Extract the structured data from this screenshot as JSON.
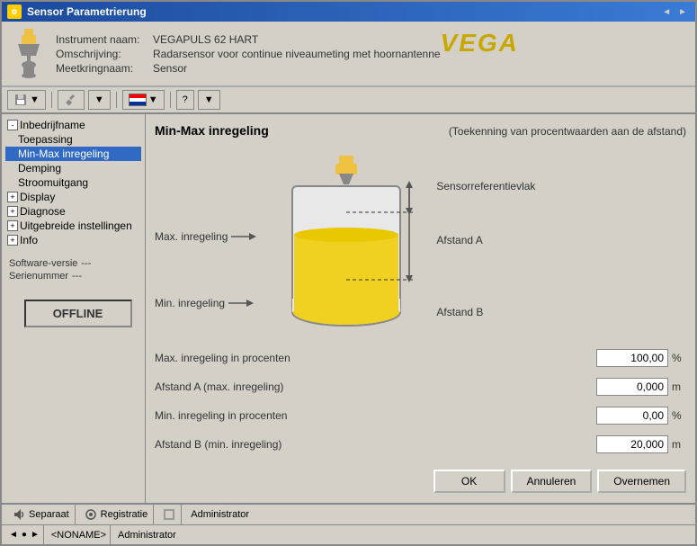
{
  "window": {
    "title": "Sensor Parametrierung",
    "nav_prev": "◄",
    "nav_next": "►"
  },
  "header": {
    "instrument_label": "Instrument naam:",
    "instrument_value": "VEGAPULS 62 HART",
    "description_label": "Omschrijving:",
    "description_value": "Radarsensor voor continue niveaumeting met hoornantenne",
    "circuit_label": "Meetkringnaam:",
    "circuit_value": "Sensor",
    "logo": "VEGA"
  },
  "toolbar": {
    "btn1": "▼",
    "btn2": "🔧",
    "btn3": "▼",
    "btn4": "?",
    "btn5": "▼"
  },
  "sidebar": {
    "items": [
      {
        "label": "Inbedrijfname",
        "level": 0,
        "expanded": true,
        "selected": false
      },
      {
        "label": "Toepassing",
        "level": 1,
        "expanded": false,
        "selected": false
      },
      {
        "label": "Min-Max inregeling",
        "level": 1,
        "expanded": false,
        "selected": true
      },
      {
        "label": "Demping",
        "level": 1,
        "expanded": false,
        "selected": false
      },
      {
        "label": "Stroomuitgang",
        "level": 1,
        "expanded": false,
        "selected": false
      },
      {
        "label": "Display",
        "level": 0,
        "expanded": false,
        "selected": false
      },
      {
        "label": "Diagnose",
        "level": 0,
        "expanded": false,
        "selected": false
      },
      {
        "label": "Uitgebreide instellingen",
        "level": 0,
        "expanded": false,
        "selected": false
      },
      {
        "label": "Info",
        "level": 0,
        "expanded": false,
        "selected": false
      }
    ],
    "software_label": "Software-versie",
    "software_value": "---",
    "serial_label": "Serienummer",
    "serial_value": "---",
    "offline_label": "OFFLINE"
  },
  "content": {
    "title": "Min-Max inregeling",
    "subtitle": "(Toekenning van procentwaarden aan de afstand)",
    "diagram": {
      "sensor_ref": "Sensorreferentievlak",
      "max_label": "Max. inregeling",
      "min_label": "Min. inregeling",
      "dist_a": "Afstand A",
      "dist_b": "Afstand B"
    },
    "form": {
      "rows": [
        {
          "label": "Max. inregeling in procenten",
          "value": "100,00",
          "unit": "%"
        },
        {
          "label": "Afstand A (max. inregeling)",
          "value": "0,000",
          "unit": "m"
        },
        {
          "label": "Min. inregeling in procenten",
          "value": "0,00",
          "unit": "%"
        },
        {
          "label": "Afstand B (min. inregeling)",
          "value": "20,000",
          "unit": "m"
        }
      ]
    },
    "buttons": {
      "ok": "OK",
      "cancel": "Annuleren",
      "apply": "Overnemen"
    }
  },
  "statusbar": {
    "separaat": "Separaat",
    "registratie": "Registratie",
    "administrator": "Administrator"
  },
  "bottombar": {
    "nav1": "◄",
    "nav2": "●",
    "nav3": "►",
    "noname": "<NONAME>",
    "admin": "Administrator"
  }
}
